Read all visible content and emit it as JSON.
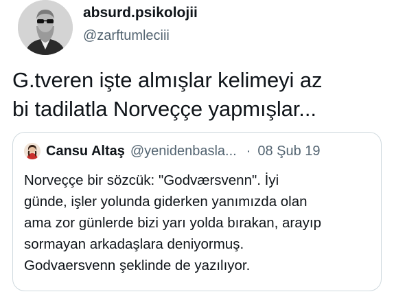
{
  "tweet": {
    "author": {
      "display_name": "absurd.psikolojii",
      "handle": "@zarftumleciii",
      "avatar_icon": "profile-photo-sunglasses-man"
    },
    "text": "G.tveren işte almışlar kelimeyi az\nbi tadilatla Norveççe yapmışlar..."
  },
  "quoted_tweet": {
    "author": {
      "display_name": "Cansu Altaş",
      "handle": "@yenidenbasla...",
      "avatar_icon": "profile-photo-woman"
    },
    "separator": "·",
    "date": "08 Şub 19",
    "text": "Norveççe bir sözcük: \"Godværsvenn\". İyi\ngünde, işler yolunda giderken yanımızda olan\nama zor günlerde bizi yarı yolda bırakan, arayıp\nsormayan arkadaşlara deniyormuş.\nGodvaersvenn şeklinde de yazılıyor."
  },
  "colors": {
    "text_primary": "#0f1419",
    "text_secondary": "#536471",
    "card_border": "#cfd9de",
    "background": "#ffffff"
  }
}
